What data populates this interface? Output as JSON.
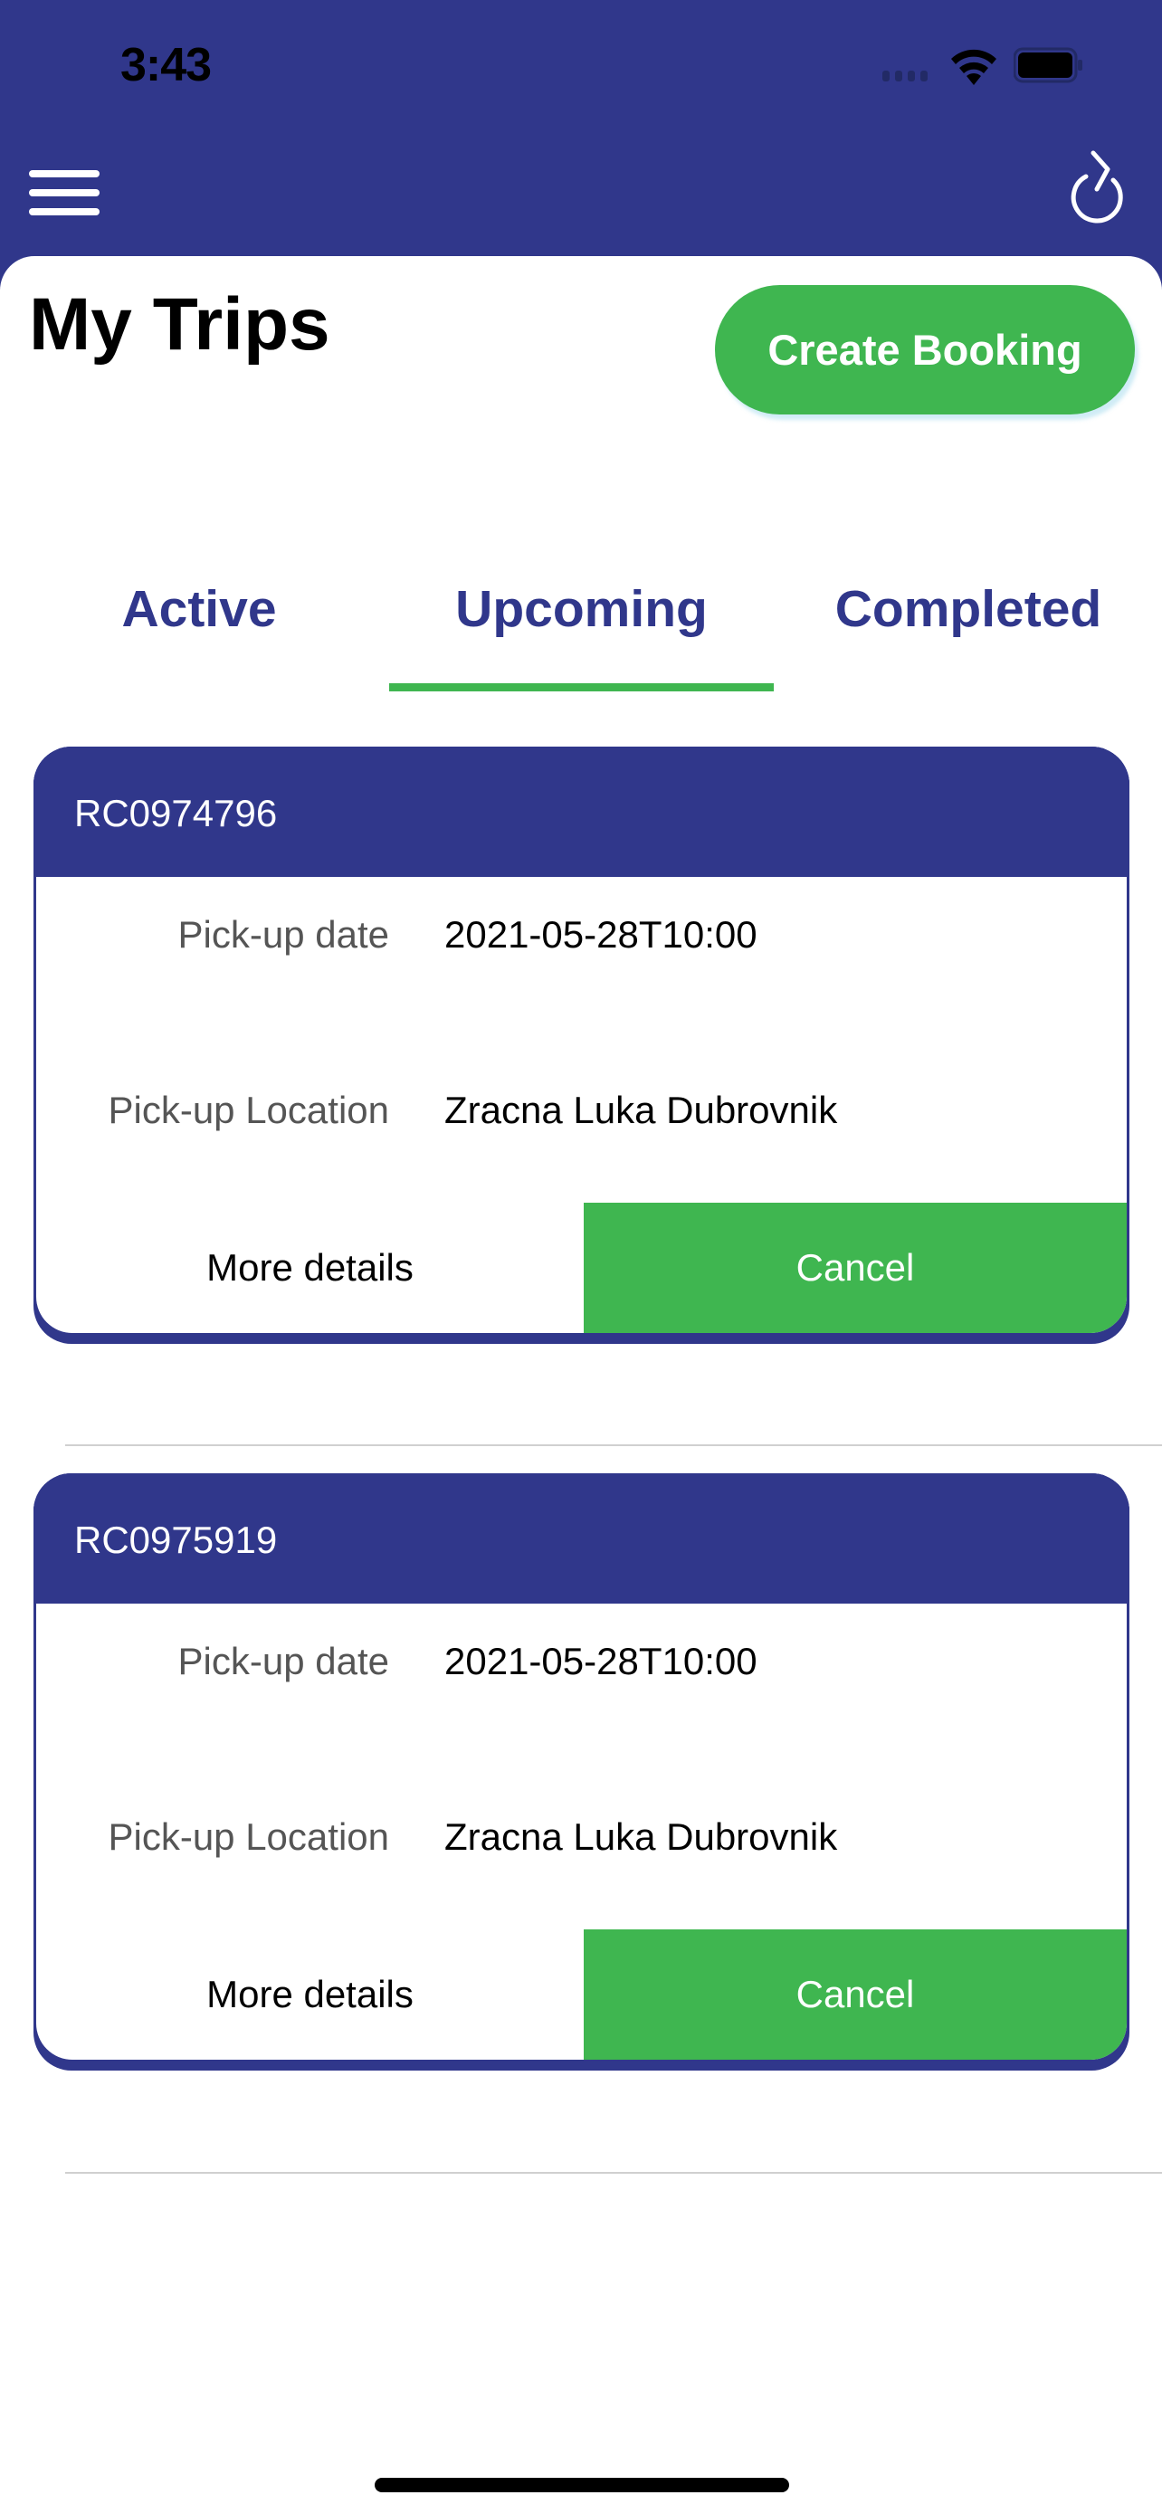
{
  "status_bar": {
    "time": "3:43"
  },
  "header": {
    "menu_icon": "hamburger-menu-icon",
    "refresh_icon": "refresh-icon",
    "title": "My Trips",
    "create_booking_label": "Create Booking"
  },
  "tabs": [
    {
      "label": "Active",
      "active": false
    },
    {
      "label": "Upcoming",
      "active": true
    },
    {
      "label": "Completed",
      "active": false
    }
  ],
  "trips": [
    {
      "id": "RC0974796",
      "pickup_date_label": "Pick-up date",
      "pickup_date": "2021-05-28T10:00",
      "pickup_location_label": "Pick-up Location",
      "pickup_location": "Zracna Luka Dubrovnik",
      "more_details_label": "More details",
      "cancel_label": "Cancel"
    },
    {
      "id": "RC0975919",
      "pickup_date_label": "Pick-up date",
      "pickup_date": "2021-05-28T10:00",
      "pickup_location_label": "Pick-up Location",
      "pickup_location": "Zracna Luka Dubrovnik",
      "more_details_label": "More details",
      "cancel_label": "Cancel"
    }
  ],
  "colors": {
    "primary": "#30378b",
    "accent": "#3fb650",
    "label_gray": "#555555"
  }
}
